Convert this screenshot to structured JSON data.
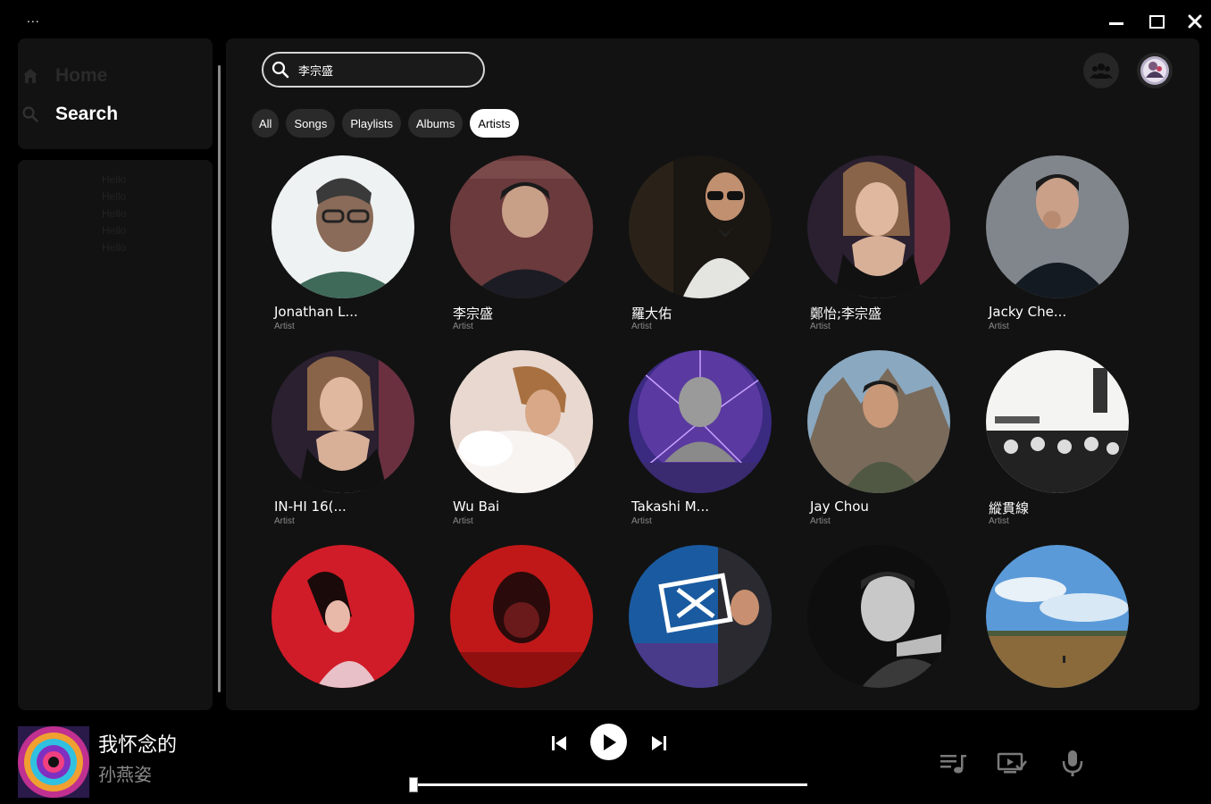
{
  "window": {
    "menu_label": "...",
    "minimize_label": "",
    "maximize_label": "",
    "close_label": ""
  },
  "sidebar": {
    "nav": [
      {
        "label": "Home",
        "icon": "home-icon",
        "active": false
      },
      {
        "label": "Search",
        "icon": "search-icon",
        "active": true
      }
    ],
    "library_items": [
      "Hello",
      "Hello",
      "Hello",
      "Hello",
      "Hello"
    ]
  },
  "search": {
    "value": "李宗盛",
    "placeholder": ""
  },
  "header": {
    "friends_icon": "friends-icon",
    "avatar_icon": "user-avatar"
  },
  "filters": [
    {
      "label": "All",
      "active": false
    },
    {
      "label": "Songs",
      "active": false
    },
    {
      "label": "Playlists",
      "active": false
    },
    {
      "label": "Albums",
      "active": false
    },
    {
      "label": "Artists",
      "active": true
    }
  ],
  "artists": [
    {
      "name": "Jonathan L...",
      "type": "Artist"
    },
    {
      "name": "李宗盛",
      "type": "Artist"
    },
    {
      "name": "羅大佑",
      "type": "Artist"
    },
    {
      "name": "鄭怡;李宗盛",
      "type": "Artist"
    },
    {
      "name": "Jacky Che...",
      "type": "Artist"
    },
    {
      "name": "IN-HI 16(...",
      "type": "Artist"
    },
    {
      "name": "Wu Bai",
      "type": "Artist"
    },
    {
      "name": "Takashi M...",
      "type": "Artist"
    },
    {
      "name": "Jay Chou",
      "type": "Artist"
    },
    {
      "name": "縱貫線",
      "type": "Artist"
    },
    {
      "name": "",
      "type": ""
    },
    {
      "name": "",
      "type": ""
    },
    {
      "name": "",
      "type": ""
    },
    {
      "name": "",
      "type": ""
    },
    {
      "name": "",
      "type": ""
    }
  ],
  "now_playing": {
    "title": "我怀念的",
    "artist": "孙燕姿",
    "progress": 0.0
  },
  "colors": {
    "background": "#000000",
    "panel": "#121212",
    "chip": "#2a2a2a",
    "muted_text": "#8a8a8a"
  }
}
